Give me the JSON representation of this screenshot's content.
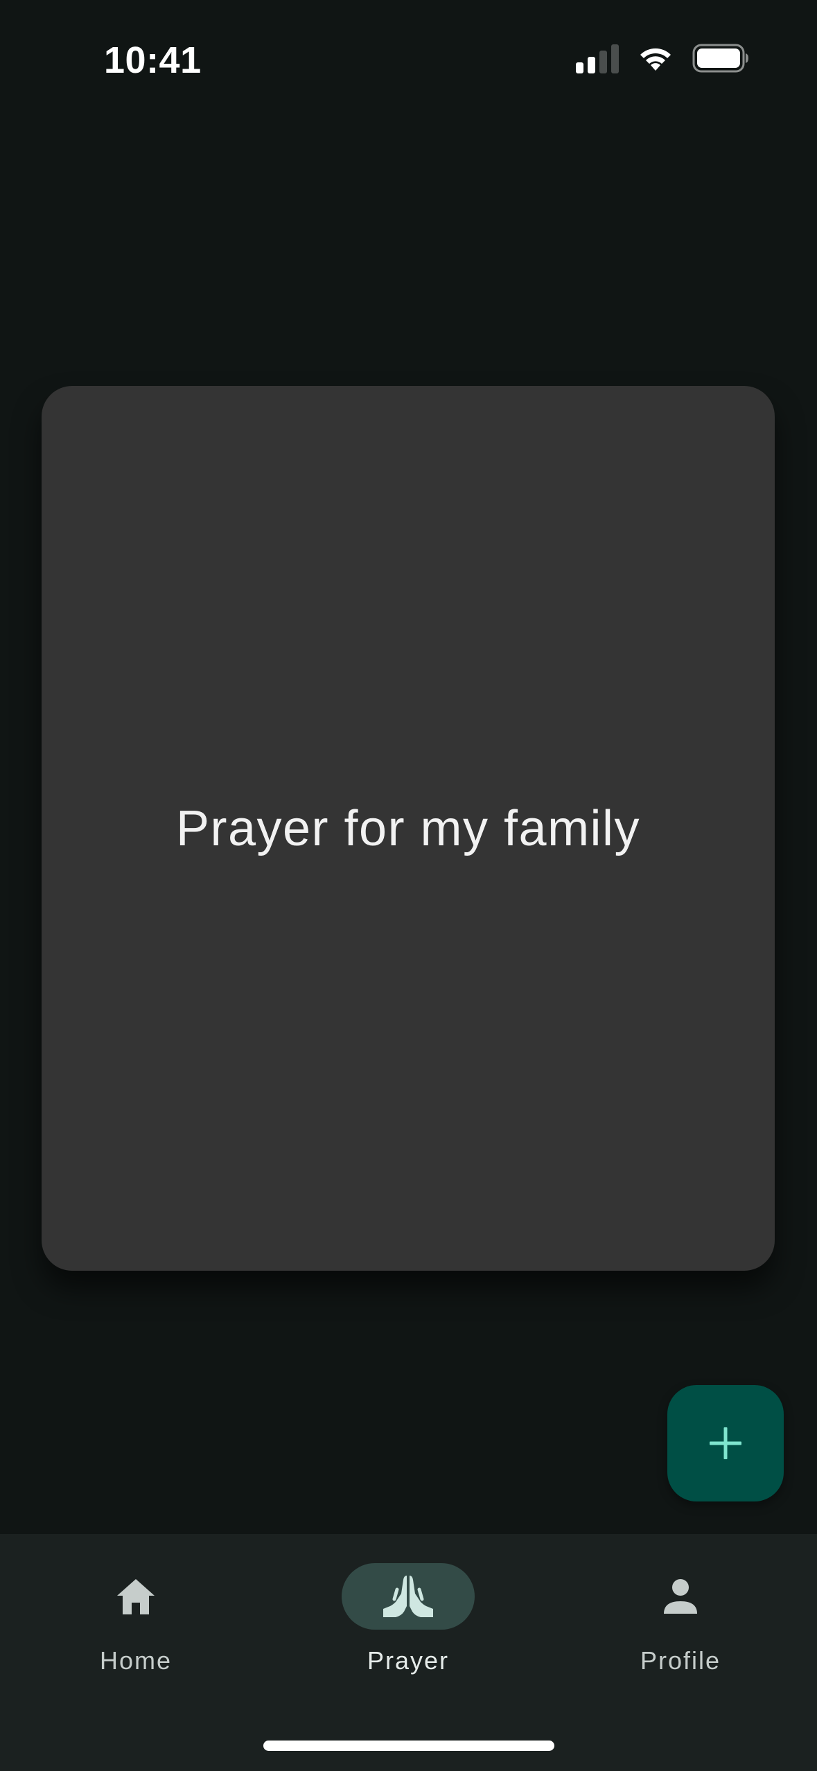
{
  "status_bar": {
    "time": "10:41",
    "signal_bars_filled": 2,
    "signal_bars_total": 4,
    "wifi": "wifi-icon",
    "battery": "battery-icon"
  },
  "card": {
    "text": "Prayer for my family"
  },
  "fab": {
    "icon": "plus-icon",
    "icon_color": "#7fe5cf",
    "background": "#004f45"
  },
  "bottom_nav": {
    "items": [
      {
        "label": "Home",
        "icon": "home-icon",
        "active": false
      },
      {
        "label": "Prayer",
        "icon": "praying-hands-icon",
        "active": true
      },
      {
        "label": "Profile",
        "icon": "person-icon",
        "active": false
      }
    ],
    "active_pill_color": "#334b47"
  },
  "colors": {
    "background": "#101514",
    "card": "#343434",
    "nav_background": "#1b2120"
  }
}
